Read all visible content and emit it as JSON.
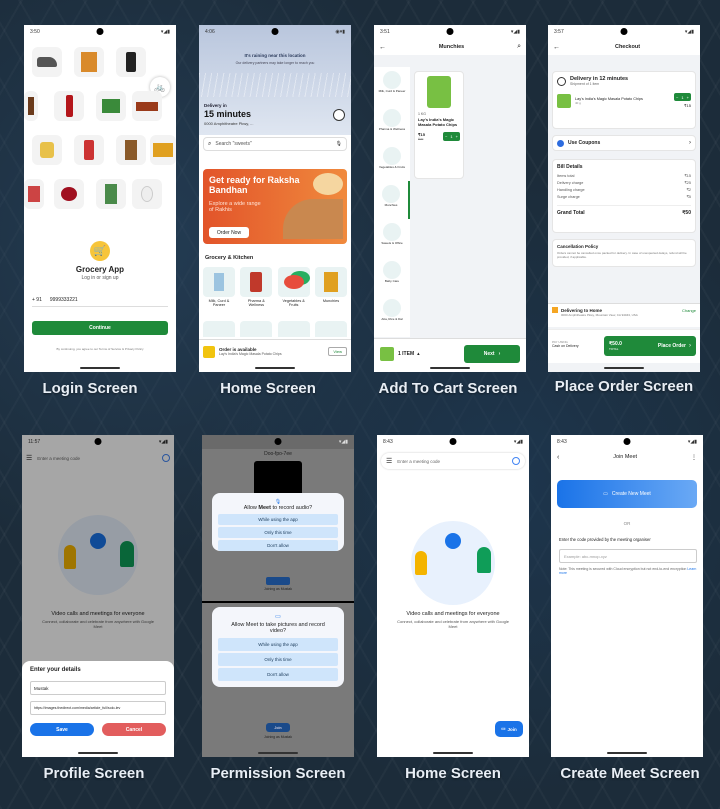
{
  "captions": {
    "login": "Login Screen",
    "home": "Home Screen",
    "cart": "Add To Cart Screen",
    "place_order": "Place Order Screen",
    "profile": "Profile Screen",
    "permission": "Permission Screen",
    "meet_home": "Home Screen",
    "create_meet": "Create Meet Screen"
  },
  "login": {
    "time": "3:50",
    "app_name": "Grocery App",
    "subtitle": "Log in or sign up",
    "country_code": "+ 91",
    "phone": "9999333221",
    "continue": "Continue",
    "terms": "By continuing, you agree to our Terms of Service & Privacy Policy"
  },
  "home": {
    "time": "4:06",
    "banner_top": "It's raining near this location",
    "banner_sub": "Our delivery partners may take longer to reach you",
    "delivery_in": "Delivery in",
    "minutes": "15 minutes",
    "address": "0000 Amphitheatre Pkwy, ...",
    "search_placeholder": "Search \"sweets\"",
    "promo_title": "Get ready for Raksha Bandhan",
    "promo_sub": "Explore a wide range of Rakhis",
    "promo_button": "Order Now",
    "section_title": "Grocery & Kitchen",
    "categories": [
      "Milk, Curd & Paneer",
      "Pharma & Wellness",
      "Vegetables & Fruits",
      "Munchies"
    ],
    "order_available": "Order is available",
    "order_item": "Lay's India's Magic Masala Potato Chips",
    "view": "View"
  },
  "cart": {
    "time": "3:51",
    "title": "Munchies",
    "side_items": [
      "Milk, Curd & Paneer",
      "Pharma & Wellness",
      "Vegetables & Fruits",
      "Munchies",
      "Sweets & Office",
      "Baby Care",
      "Atta, Rice & Dal"
    ],
    "product_weight": "1 KG",
    "product_name": "Lay's India's Magic Masala Potato Chips",
    "price": "₹15",
    "mrp": "₹20",
    "qty": "1",
    "items_label": "1 ITEM",
    "next": "Next"
  },
  "place_order": {
    "time": "3:57",
    "title": "Checkout",
    "delivery": "Delivery in 12 minutes",
    "shipment": "Shipment of 1 item",
    "product": "Lay's India's Magic Masala Potato Chips",
    "product_weight": "40 g",
    "qty": "1",
    "product_price": "₹15",
    "coupons": "Use Coupons",
    "bill_title": "Bill Details",
    "bill_rows": [
      {
        "label": "Items total",
        "value": "₹15"
      },
      {
        "label": "Delivery charge",
        "value": "₹25"
      },
      {
        "label": "Handling charge",
        "value": "₹2"
      },
      {
        "label": "Surge charge",
        "value": "₹5"
      }
    ],
    "grand_label": "Grand Total",
    "grand_value": "₹50",
    "cancel_title": "Cancellation Policy",
    "cancel_text": "Orders cannot be cancelled once packed for delivery. In case of unexpected delays, refund will be provided, if applicable.",
    "delivering": "Delivering to Home",
    "deliver_addr": "0000 Amphitheatre Pkwy, Mountain View, CA 94043, USA",
    "change": "Change",
    "pay_using": "PAY USING",
    "cash": "Cash on Delivery",
    "total": "₹50.0",
    "total_label": "TOTAL",
    "place_order": "Place Order"
  },
  "profile": {
    "time": "11:57",
    "search_placeholder": "Enter a meeting code",
    "tagline": "Video calls and meetings for everyone",
    "tagline_sub": "Connect, collaborate and celebrate from anywhere with Google Meet",
    "sheet_title": "Enter your details",
    "name": "Mustak",
    "url": "https://images.thedirect.com/media/article_full/solo-lev",
    "save": "Save",
    "cancel": "Cancel"
  },
  "permission": {
    "top_label": "Doo-fpo-7ee",
    "audio_title_1": "Allow ",
    "audio_bold": "Meet",
    "audio_title_2": " to record audio?",
    "video_title": "Allow Meet to take pictures and record video?",
    "options": [
      "While using the app",
      "Only this time",
      "Don't allow"
    ],
    "joining": "Joining as Mustak",
    "join": "Join"
  },
  "meet_home": {
    "time": "8:43",
    "search_placeholder": "Enter a meeting code",
    "tagline": "Video calls and meetings for everyone",
    "tagline_sub": "Connect, collaborate and celebrate from anywhere with Google Meet",
    "join": "Join"
  },
  "create_meet": {
    "time": "8:43",
    "title": "Join Meet",
    "create": "Create New Meet",
    "or": "OR",
    "code_label": "Enter the code provided by the meeting organiser",
    "code_placeholder": "Example: abc-mnop-xyz",
    "note": "Note: This meeting is secured with Cloud encryption but not end-to-end encryption",
    "learn": "Learn more"
  }
}
